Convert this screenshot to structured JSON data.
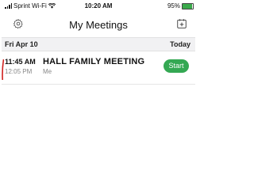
{
  "status_bar": {
    "carrier": "Sprint Wi-Fi",
    "time": "10:20 AM",
    "battery": "95%"
  },
  "header": {
    "title": "My Meetings",
    "settings_icon": "gear-icon",
    "add_icon": "calendar-add-icon"
  },
  "section": {
    "date": "Fri Apr 10",
    "relative": "Today"
  },
  "meetings": [
    {
      "start_time": "11:45 AM",
      "end_time": "12:05 PM",
      "title": "HALL FAMILY MEETING",
      "host": "Me",
      "action_label": "Start"
    }
  ],
  "colors": {
    "start_button": "#34a853",
    "section_bg": "#f1f1f3",
    "annotation_mark": "#d0201e"
  }
}
